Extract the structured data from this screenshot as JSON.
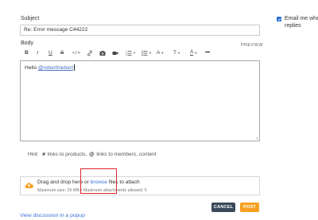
{
  "form": {
    "subject_label": "Subject",
    "subject_value": "Re: Error message C44222",
    "body_label": "Body",
    "preview_label": "PREVIEW"
  },
  "toolbar": {
    "bold": "B",
    "italic": "I",
    "underline": "U",
    "strike": "S",
    "code": "</>",
    "font": "A",
    "size": "T",
    "color": "A",
    "more": "•••"
  },
  "editor": {
    "greeting": "Hello ",
    "mention": "@roberthiebert"
  },
  "hint": {
    "prefix": "Hint:",
    "hash_symbol": "#",
    "products_text": "links to products,",
    "at_symbol": "@",
    "members_text": "links to members, content"
  },
  "attach": {
    "text_before": "Drag and drop here or ",
    "browse": "browse",
    "text_after": " files to attach",
    "meta": "Maximum size: 25 MB • Maximum attachments allowed: 5"
  },
  "buttons": {
    "cancel": "CANCEL",
    "post": "POST"
  },
  "links": {
    "popup": "View discussion in a popup"
  },
  "notify": {
    "checked": true,
    "label_line1": "Email me whe",
    "label_line2": "replies"
  },
  "icons": {
    "link": "link-icon",
    "image": "camera-icon",
    "video": "video-icon",
    "ordered_list": "ordered-list-icon",
    "unordered_list": "unordered-list-icon",
    "upload": "cloud-upload-icon"
  },
  "colors": {
    "accent": "#f7a021",
    "link": "#3b6fd6",
    "cancel_bg": "#3a4a5c",
    "highlight": "#e0242c"
  }
}
